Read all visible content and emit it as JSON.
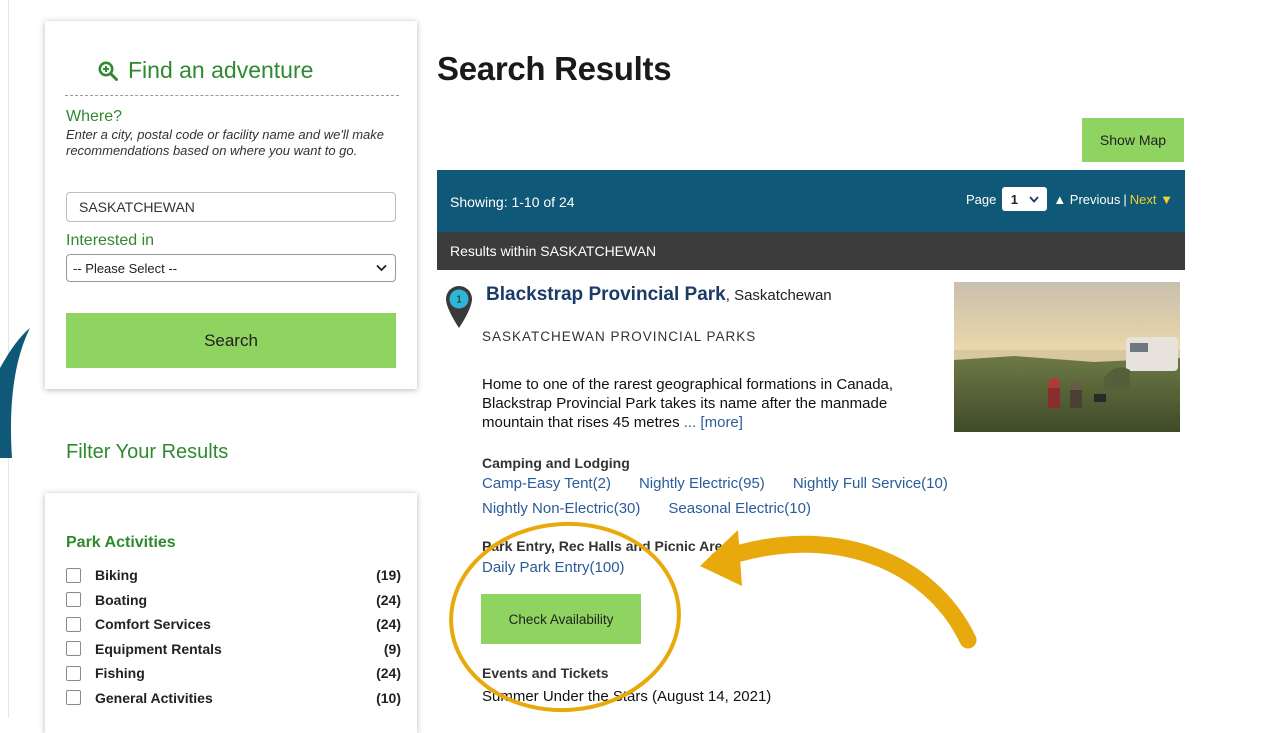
{
  "search": {
    "title": "Find an adventure",
    "where_label": "Where?",
    "where_help": "Enter a city, postal code or facility name and we'll make recommendations based on where you want to go.",
    "where_value": "SASKATCHEWAN",
    "interested_label": "Interested in",
    "interested_selected": "-- Please Select --",
    "search_button": "Search"
  },
  "filter": {
    "title": "Filter Your Results",
    "section_title": "Park Activities",
    "activities": [
      {
        "name": "Biking",
        "count": "(19)"
      },
      {
        "name": "Boating",
        "count": "(24)"
      },
      {
        "name": "Comfort Services",
        "count": "(24)"
      },
      {
        "name": "Equipment Rentals",
        "count": "(9)"
      },
      {
        "name": "Fishing",
        "count": "(24)"
      },
      {
        "name": "General Activities",
        "count": "(10)"
      }
    ]
  },
  "results": {
    "title": "Search Results",
    "show_map": "Show Map",
    "showing": "Showing: 1-10 of 24",
    "page_label": "Page",
    "page_value": "1",
    "prev_label": "▲ Previous",
    "separator": "|",
    "next_label": "Next ▼",
    "within": "Results within SASKATCHEWAN"
  },
  "park": {
    "marker": "1",
    "name": "Blackstrap Provincial Park",
    "province": ", Saskatchewan",
    "org": "SASKATCHEWAN PROVINCIAL PARKS",
    "description": "Home to one of the rarest geographical formations in Canada, Blackstrap Provincial Park takes its name after the manmade mountain that rises 45 metres",
    "more": "... [more]",
    "camping_title": "Camping and Lodging",
    "camping_row1": [
      "Camp-Easy Tent(2)",
      "Nightly Electric(95)",
      "Nightly Full Service(10)"
    ],
    "camping_row2": [
      "Nightly Non-Electric(30)",
      "Seasonal Electric(10)"
    ],
    "entry_title": "Park Entry, Rec Halls and Picnic Areas",
    "entry_link": "Daily Park Entry(100)",
    "check_button": "Check Availability",
    "events_title": "Events and Tickets",
    "event": "Summer Under the Stars (August 14, 2021)"
  },
  "colors": {
    "accent_green": "#8fd460",
    "heading_green": "#2f8a2f",
    "bar_blue": "#0f5877",
    "bar_dark": "#3c3c3c",
    "annotation": "#e8a90c"
  }
}
